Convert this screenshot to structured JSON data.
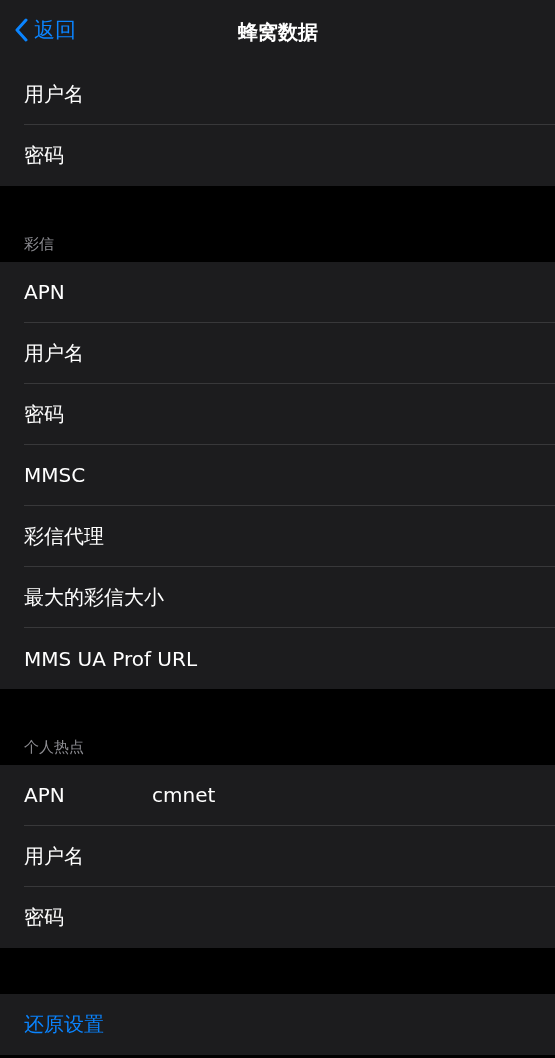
{
  "nav_bar": {
    "back": "返回",
    "title": "蜂窝数据"
  },
  "sections": [
    {
      "items": [
        {
          "label": "用户名"
        },
        {
          "label": "密码"
        }
      ]
    },
    {
      "header": "彩信",
      "items": [
        {
          "label": "APN"
        },
        {
          "label": "用户名"
        },
        {
          "label": "密码"
        },
        {
          "label": "MMSC"
        },
        {
          "label": "彩信代理"
        },
        {
          "label": "最大的彩信大小"
        },
        {
          "label": "MMS UA Prof URL"
        }
      ]
    },
    {
      "header": "个人热点",
      "items": [
        {
          "label": "APN",
          "value": "cmnet"
        },
        {
          "label": "用户名"
        },
        {
          "label": "密码"
        }
      ]
    }
  ],
  "reset_button": "还原设置"
}
